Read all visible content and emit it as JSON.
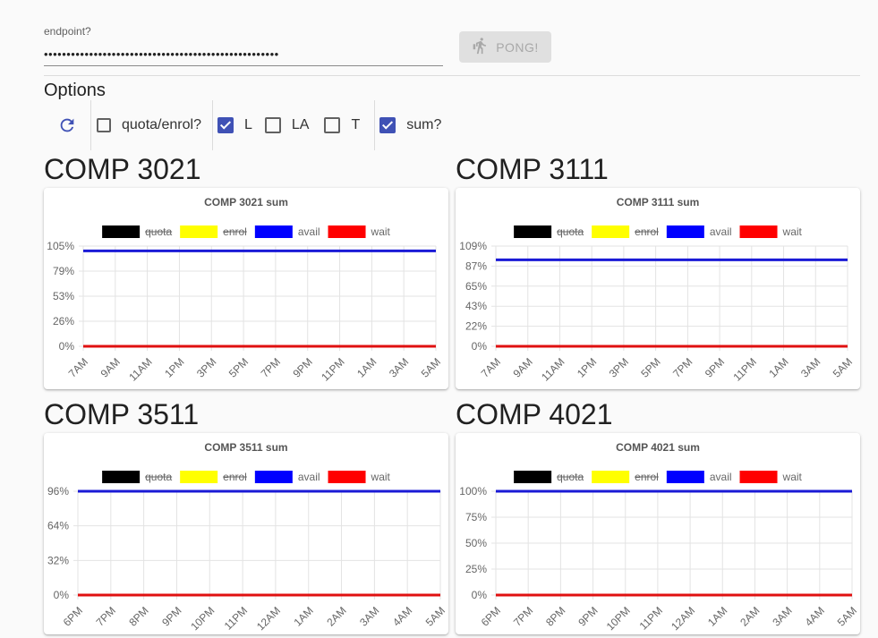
{
  "endpoint": {
    "label": "endpoint?",
    "value": "••••••••••••••••••••••••••••••••••••••••••••••••••••"
  },
  "pong_button": {
    "label": "PONG!",
    "icon": "walking-icon",
    "disabled": true
  },
  "options": {
    "title": "Options",
    "refresh_icon": "refresh-icon",
    "checkboxes": [
      {
        "label": "quota/enrol?",
        "checked": false
      },
      {
        "label": "L",
        "checked": true
      },
      {
        "label": "LA",
        "checked": false
      },
      {
        "label": "T",
        "checked": false
      },
      {
        "label": "sum?",
        "checked": true
      }
    ]
  },
  "colors": {
    "accent": "#3f51b5"
  },
  "courses": [
    {
      "title": "COMP 3021",
      "chart_data": {
        "type": "line",
        "title": "COMP 3021 sum",
        "x": [
          "7AM",
          "9AM",
          "11AM",
          "1PM",
          "3PM",
          "5PM",
          "7PM",
          "9PM",
          "11PM",
          "1AM",
          "3AM",
          "5AM"
        ],
        "y_ticks": [
          "105%",
          "79%",
          "53%",
          "26%",
          "0%"
        ],
        "ylim": [
          0,
          105
        ],
        "grid": true,
        "legend_position": "top",
        "series": [
          {
            "name": "quota",
            "color": "#000000",
            "hidden": true,
            "values": []
          },
          {
            "name": "enrol",
            "color": "#ffff00",
            "hidden": true,
            "values": []
          },
          {
            "name": "avail",
            "color": "#0000ff",
            "hidden": false,
            "values": [
              100,
              100,
              100,
              100,
              100,
              100,
              100,
              100,
              100,
              100,
              100,
              100
            ]
          },
          {
            "name": "wait",
            "color": "#ff0000",
            "hidden": false,
            "values": [
              0,
              0,
              0,
              0,
              0,
              0,
              0,
              0,
              0,
              0,
              0,
              0
            ]
          }
        ]
      }
    },
    {
      "title": "COMP 3111",
      "chart_data": {
        "type": "line",
        "title": "COMP 3111 sum",
        "x": [
          "7AM",
          "9AM",
          "11AM",
          "1PM",
          "3PM",
          "5PM",
          "7PM",
          "9PM",
          "11PM",
          "1AM",
          "3AM",
          "5AM"
        ],
        "y_ticks": [
          "109%",
          "87%",
          "65%",
          "43%",
          "22%",
          "0%"
        ],
        "ylim": [
          0,
          109
        ],
        "grid": true,
        "legend_position": "top",
        "series": [
          {
            "name": "quota",
            "color": "#000000",
            "hidden": true,
            "values": []
          },
          {
            "name": "enrol",
            "color": "#ffff00",
            "hidden": true,
            "values": []
          },
          {
            "name": "avail",
            "color": "#0000ff",
            "hidden": false,
            "values": [
              94,
              94,
              94,
              94,
              94,
              94,
              94,
              94,
              94,
              94,
              94,
              94
            ]
          },
          {
            "name": "wait",
            "color": "#ff0000",
            "hidden": false,
            "values": [
              0,
              0,
              0,
              0,
              0,
              0,
              0,
              0,
              0,
              0,
              0,
              0
            ]
          }
        ]
      }
    },
    {
      "title": "COMP 3511",
      "chart_data": {
        "type": "line",
        "title": "COMP 3511 sum",
        "x": [
          "6PM",
          "7PM",
          "8PM",
          "9PM",
          "10PM",
          "11PM",
          "12AM",
          "1AM",
          "2AM",
          "3AM",
          "4AM",
          "5AM"
        ],
        "y_ticks": [
          "96%",
          "64%",
          "32%",
          "0%"
        ],
        "ylim": [
          0,
          96
        ],
        "grid": true,
        "legend_position": "top",
        "series": [
          {
            "name": "quota",
            "color": "#000000",
            "hidden": true,
            "values": []
          },
          {
            "name": "enrol",
            "color": "#ffff00",
            "hidden": true,
            "values": []
          },
          {
            "name": "avail",
            "color": "#0000ff",
            "hidden": false,
            "values": [
              96,
              96,
              96,
              96,
              96,
              96,
              96,
              96,
              96,
              96,
              96,
              96
            ]
          },
          {
            "name": "wait",
            "color": "#ff0000",
            "hidden": false,
            "values": [
              0,
              0,
              0,
              0,
              0,
              0,
              0,
              0,
              0,
              0,
              0,
              0
            ]
          }
        ]
      }
    },
    {
      "title": "COMP 4021",
      "chart_data": {
        "type": "line",
        "title": "COMP 4021 sum",
        "x": [
          "6PM",
          "7PM",
          "8PM",
          "9PM",
          "10PM",
          "11PM",
          "12AM",
          "1AM",
          "2AM",
          "3AM",
          "4AM",
          "5AM"
        ],
        "y_ticks": [
          "100%",
          "75%",
          "50%",
          "25%",
          "0%"
        ],
        "ylim": [
          0,
          100
        ],
        "grid": true,
        "legend_position": "top",
        "series": [
          {
            "name": "quota",
            "color": "#000000",
            "hidden": true,
            "values": []
          },
          {
            "name": "enrol",
            "color": "#ffff00",
            "hidden": true,
            "values": []
          },
          {
            "name": "avail",
            "color": "#0000ff",
            "hidden": false,
            "values": [
              100,
              100,
              100,
              100,
              100,
              100,
              100,
              100,
              100,
              100,
              100,
              100
            ]
          },
          {
            "name": "wait",
            "color": "#ff0000",
            "hidden": false,
            "values": [
              0,
              0,
              0,
              0,
              0,
              0,
              0,
              0,
              0,
              0,
              0,
              0
            ]
          }
        ]
      }
    }
  ]
}
